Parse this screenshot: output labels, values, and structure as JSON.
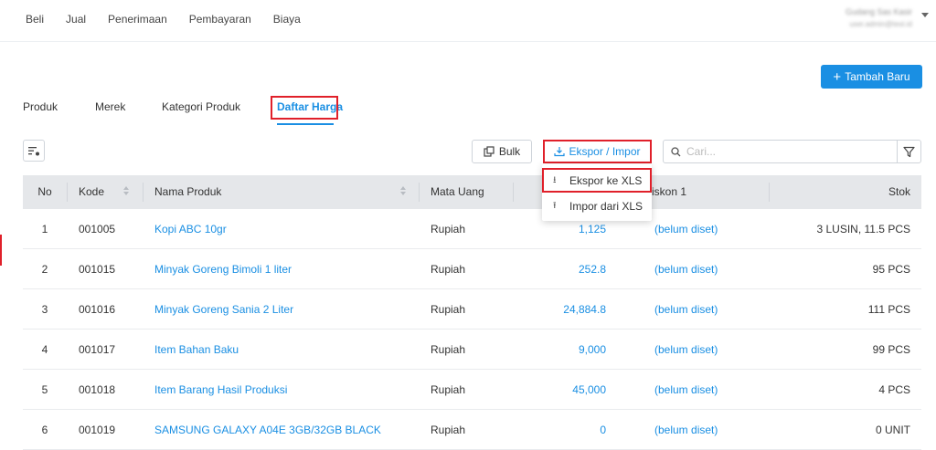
{
  "nav": {
    "items": [
      "Beli",
      "Jual",
      "Penerimaan",
      "Pembayaran",
      "Biaya"
    ]
  },
  "user": {
    "name": "Gudang Sas Kasir",
    "email": "user.admin@test.id"
  },
  "actions": {
    "add_label": "Tambah Baru"
  },
  "tabs": [
    {
      "label": "Produk"
    },
    {
      "label": "Merek"
    },
    {
      "label": "Kategori Produk"
    },
    {
      "label": "Daftar Harga"
    }
  ],
  "active_tab": "Daftar Harga",
  "toolbar": {
    "bulk_label": "Bulk",
    "export_label": "Ekspor / Impor",
    "search_placeholder": "Cari..."
  },
  "dropdown": {
    "items": [
      {
        "label": "Ekspor ke XLS",
        "icon": "download-icon"
      },
      {
        "label": "Impor dari XLS",
        "icon": "upload-icon"
      }
    ]
  },
  "table": {
    "columns": [
      "No",
      "Kode",
      "Nama Produk",
      "Mata Uang",
      "",
      "iskon 1",
      "Stok"
    ],
    "rows": [
      {
        "no": "1",
        "kode": "001005",
        "nama": "Kopi ABC 10gr",
        "mata_uang": "Rupiah",
        "harga": "1,125",
        "diskon": "(belum diset)",
        "stok": "3 LUSIN, 11.5 PCS"
      },
      {
        "no": "2",
        "kode": "001015",
        "nama": "Minyak Goreng Bimoli 1 liter",
        "mata_uang": "Rupiah",
        "harga": "252.8",
        "diskon": "(belum diset)",
        "stok": "95 PCS"
      },
      {
        "no": "3",
        "kode": "001016",
        "nama": "Minyak Goreng Sania 2 Liter",
        "mata_uang": "Rupiah",
        "harga": "24,884.8",
        "diskon": "(belum diset)",
        "stok": "111 PCS"
      },
      {
        "no": "4",
        "kode": "001017",
        "nama": "Item Bahan Baku",
        "mata_uang": "Rupiah",
        "harga": "9,000",
        "diskon": "(belum diset)",
        "stok": "99 PCS"
      },
      {
        "no": "5",
        "kode": "001018",
        "nama": "Item Barang Hasil Produksi",
        "mata_uang": "Rupiah",
        "harga": "45,000",
        "diskon": "(belum diset)",
        "stok": "4 PCS"
      },
      {
        "no": "6",
        "kode": "001019",
        "nama": "SAMSUNG GALAXY A04E 3GB/32GB BLACK",
        "mata_uang": "Rupiah",
        "harga": "0",
        "diskon": "(belum diset)",
        "stok": "0 UNIT"
      }
    ]
  },
  "colors": {
    "accent": "#1a8fe3",
    "highlight": "#e0202a",
    "header_bg": "#e5e7ea"
  }
}
